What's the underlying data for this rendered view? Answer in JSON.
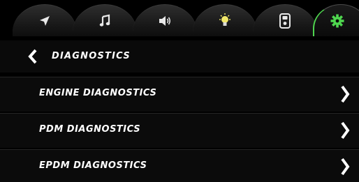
{
  "tabs": [
    {
      "name": "navigation",
      "icon": "navigation-arrow-icon",
      "active": false
    },
    {
      "name": "music",
      "icon": "music-note-icon",
      "active": false
    },
    {
      "name": "volume",
      "icon": "speaker-icon",
      "active": false
    },
    {
      "name": "lights",
      "icon": "light-bulb-icon",
      "active": false
    },
    {
      "name": "remote",
      "icon": "remote-control-icon",
      "active": false
    },
    {
      "name": "settings",
      "icon": "gear-icon",
      "active": true
    }
  ],
  "header": {
    "title": "DIAGNOSTICS",
    "back_icon": "chevron-left-icon"
  },
  "menu": {
    "items": [
      {
        "label": "ENGINE DIAGNOSTICS"
      },
      {
        "label": "PDM DIAGNOSTICS"
      },
      {
        "label": "EPDM DIAGNOSTICS"
      }
    ],
    "chevron_icon": "chevron-right-icon"
  },
  "colors": {
    "background": "#000000",
    "text": "#ffffff",
    "accent": "#4fd64f",
    "icon_inactive": "#e8e8e8",
    "bulb": "#f2e86a"
  }
}
